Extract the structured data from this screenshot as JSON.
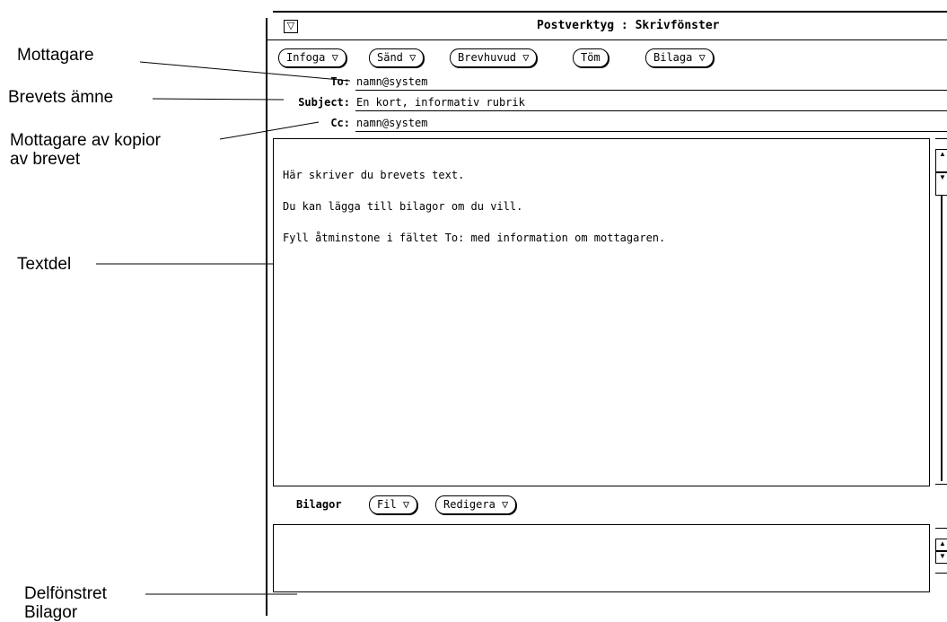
{
  "callouts": {
    "recipient": "Mottagare",
    "subject": "Brevets ämne",
    "cc_line1": "Mottagare av kopior",
    "cc_line2": "av brevet",
    "text_part": "Textdel",
    "attach_line1": "Delfönstret",
    "attach_line2": "Bilagor"
  },
  "window": {
    "title": "Postverktyg : Skrivfönster",
    "menu_glyph": "▽"
  },
  "toolbar": [
    {
      "label": "Infoga ▽"
    },
    {
      "label": "Sänd ▽"
    },
    {
      "label": "Brevhuvud ▽"
    },
    {
      "label": "Töm"
    },
    {
      "label": "Bilaga ▽"
    }
  ],
  "fields": {
    "to_label": "To:",
    "to_value": "namn@system",
    "subject_label": "Subject:",
    "subject_value": "En kort, informativ rubrik",
    "cc_label": "Cc:",
    "cc_value": "namn@system"
  },
  "body": {
    "line1": "Här skriver du brevets text.",
    "line2": "Du kan lägga till bilagor om du vill.",
    "line3": "Fyll åtminstone i fältet To: med information om mottagaren."
  },
  "attachments": {
    "label": "Bilagor",
    "file_button": "Fil ▽",
    "edit_button": "Redigera ▽"
  },
  "icons": [
    "window-menu-icon",
    "scroll-up-arrow-icon",
    "scroll-down-arrow-icon"
  ]
}
